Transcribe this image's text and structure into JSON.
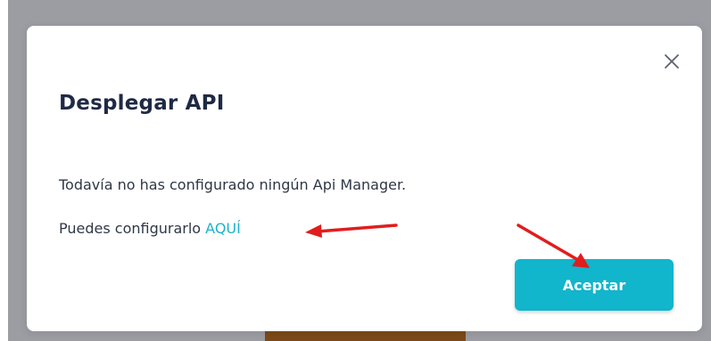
{
  "dialog": {
    "title": "Desplegar API",
    "message": "Todavía no has configurado ningún Api Manager.",
    "config_prefix": "Puedes configurarlo ",
    "config_link": "AQUÍ",
    "accept_label": "Aceptar",
    "close_icon": "close-icon"
  },
  "colors": {
    "accent": "#11b5cc",
    "link": "#1bb3c8",
    "title": "#1f2a44",
    "annotation_arrow": "#e11d1d"
  }
}
